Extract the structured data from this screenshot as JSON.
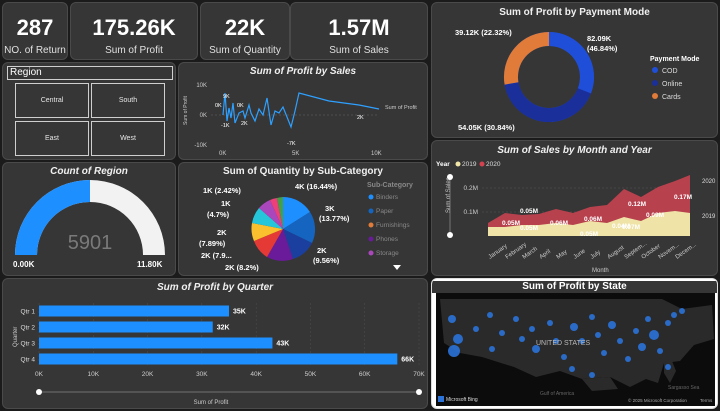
{
  "kpis": [
    {
      "value": "287",
      "label": "NO. of Return"
    },
    {
      "value": "175.26K",
      "label": "Sum of Profit"
    },
    {
      "value": "22K",
      "label": "Sum of Quantity"
    },
    {
      "value": "1.57M",
      "label": "Sum of Sales"
    }
  ],
  "region_slicer": {
    "title": "Region",
    "options": [
      "Central",
      "South",
      "East",
      "West"
    ]
  },
  "profit_by_sales": {
    "title": "Sum of Profit by Sales",
    "ylabel": "Sum of Profit",
    "xlabel": "",
    "yticks": [
      "10K",
      "0K",
      "-10K"
    ],
    "xticks": [
      "0K",
      "5K",
      "10K"
    ],
    "annotations": [
      "9K",
      "0K",
      "0K",
      "-1K",
      "2K",
      "-7K",
      "2K"
    ],
    "legend": "Sum of Profit"
  },
  "payment_mode": {
    "title": "Sum of Profit by Payment Mode",
    "legend_title": "Payment Mode",
    "labels": [
      "82.09K\n(46.84%)",
      "54.05K (30.84%)",
      "39.12K (22.32%)"
    ],
    "label_top": "39.12K (22.32%)",
    "label_right_1": "82.09K",
    "label_right_2": "(46.84%)",
    "label_bottom": "54.05K (30.84%)",
    "legend": [
      {
        "name": "COD",
        "color": "#1f4fd8"
      },
      {
        "name": "Online",
        "color": "#1a2f9a"
      },
      {
        "name": "Cards",
        "color": "#e07b39"
      }
    ]
  },
  "count_region": {
    "title": "Count of Region",
    "value": "5901",
    "min": "0.00K",
    "max": "11.80K",
    "fraction": 0.5
  },
  "qty_subcategory": {
    "title": "Sum of Quantity by Sub-Category",
    "legend_title": "Sub-Category",
    "legend": [
      "Binders",
      "Paper",
      "Furnishings",
      "Phones",
      "Storage"
    ],
    "labels": [
      "1K (2.42%)",
      "1K",
      "(4.7%)",
      "2K",
      "(7.89%)",
      "2K (7.9...",
      "2K (8.2%)",
      "4K (16.44%)",
      "3K",
      "(13.77%)",
      "2K",
      "(9.56%)"
    ]
  },
  "sales_month": {
    "title": "Sum of Sales by Month and Year",
    "legend_title": "Year",
    "legend": [
      {
        "name": "2019",
        "color": "#f2e6a8"
      },
      {
        "name": "2020",
        "color": "#d2424f"
      }
    ],
    "ylabel": "Sum of Sales",
    "xlabel": "Month",
    "yticks": [
      "0.2M",
      "0.1M"
    ],
    "months": [
      "January",
      "February",
      "March",
      "April",
      "May",
      "June",
      "July",
      "August",
      "Septem...",
      "October",
      "Novem...",
      "Decem..."
    ],
    "data_labels": [
      "0.05M",
      "0.05M",
      "0.05M",
      "0.06M",
      "0.06M",
      "0.04M",
      "0.05M",
      "0.07M",
      "0.09M",
      "0.12M",
      "0.17M"
    ],
    "end_labels": [
      "2020",
      "2019"
    ]
  },
  "profit_quarter": {
    "title": "Sum of Profit by Quarter",
    "ylabel": "Quarter",
    "xlabel": "Sum of Profit",
    "xticks": [
      "0K",
      "10K",
      "20K",
      "30K",
      "40K",
      "50K",
      "60K",
      "70K"
    ],
    "xmax": 70,
    "bar_color": "#1e8fff"
  },
  "chart_data": {
    "type": "bar",
    "categories": [
      "Qtr 1",
      "Qtr 2",
      "Qtr 3",
      "Qtr 4"
    ],
    "values": [
      35,
      32,
      43,
      66
    ],
    "value_labels": [
      "35K",
      "32K",
      "43K",
      "66K"
    ],
    "title": "Sum of Profit by Quarter",
    "xlabel": "Sum of Profit",
    "ylabel": "Quarter",
    "xlim": [
      0,
      70
    ]
  },
  "profit_state": {
    "title": "Sum of Profit by State",
    "country_label": "UNITED STATES",
    "bing": "Microsoft Bing",
    "copyright": "© 2025 Microsoft Corporation",
    "terms": "Terms",
    "sea": "Sargasso Sea",
    "gulf": "Gulf of America"
  }
}
